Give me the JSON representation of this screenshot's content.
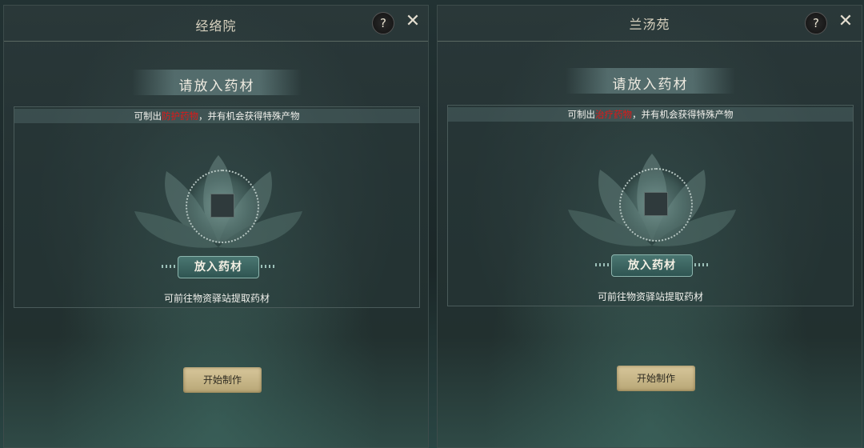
{
  "panels": [
    {
      "title": "经络院",
      "help_label": "?",
      "close_label": "✕",
      "subtitle": "请放入药材",
      "hint_prefix": "可制出",
      "hint_highlight": "防护药物",
      "hint_suffix": "，并有机会获得特殊产物",
      "put_button": "放入药材",
      "desc": "可前往物资驿站提取药材",
      "start_button": "开始制作"
    },
    {
      "title": "兰汤苑",
      "help_label": "?",
      "close_label": "✕",
      "subtitle": "请放入药材",
      "hint_prefix": "可制出",
      "hint_highlight": "治疗药物",
      "hint_suffix": "，并有机会获得特殊产物",
      "put_button": "放入药材",
      "desc": "可前往物资驿站提取药材",
      "start_button": "开始制作"
    }
  ],
  "colors": {
    "highlight": "#e01818",
    "start_button": "#c9b88a",
    "put_button": "#3d6662"
  }
}
